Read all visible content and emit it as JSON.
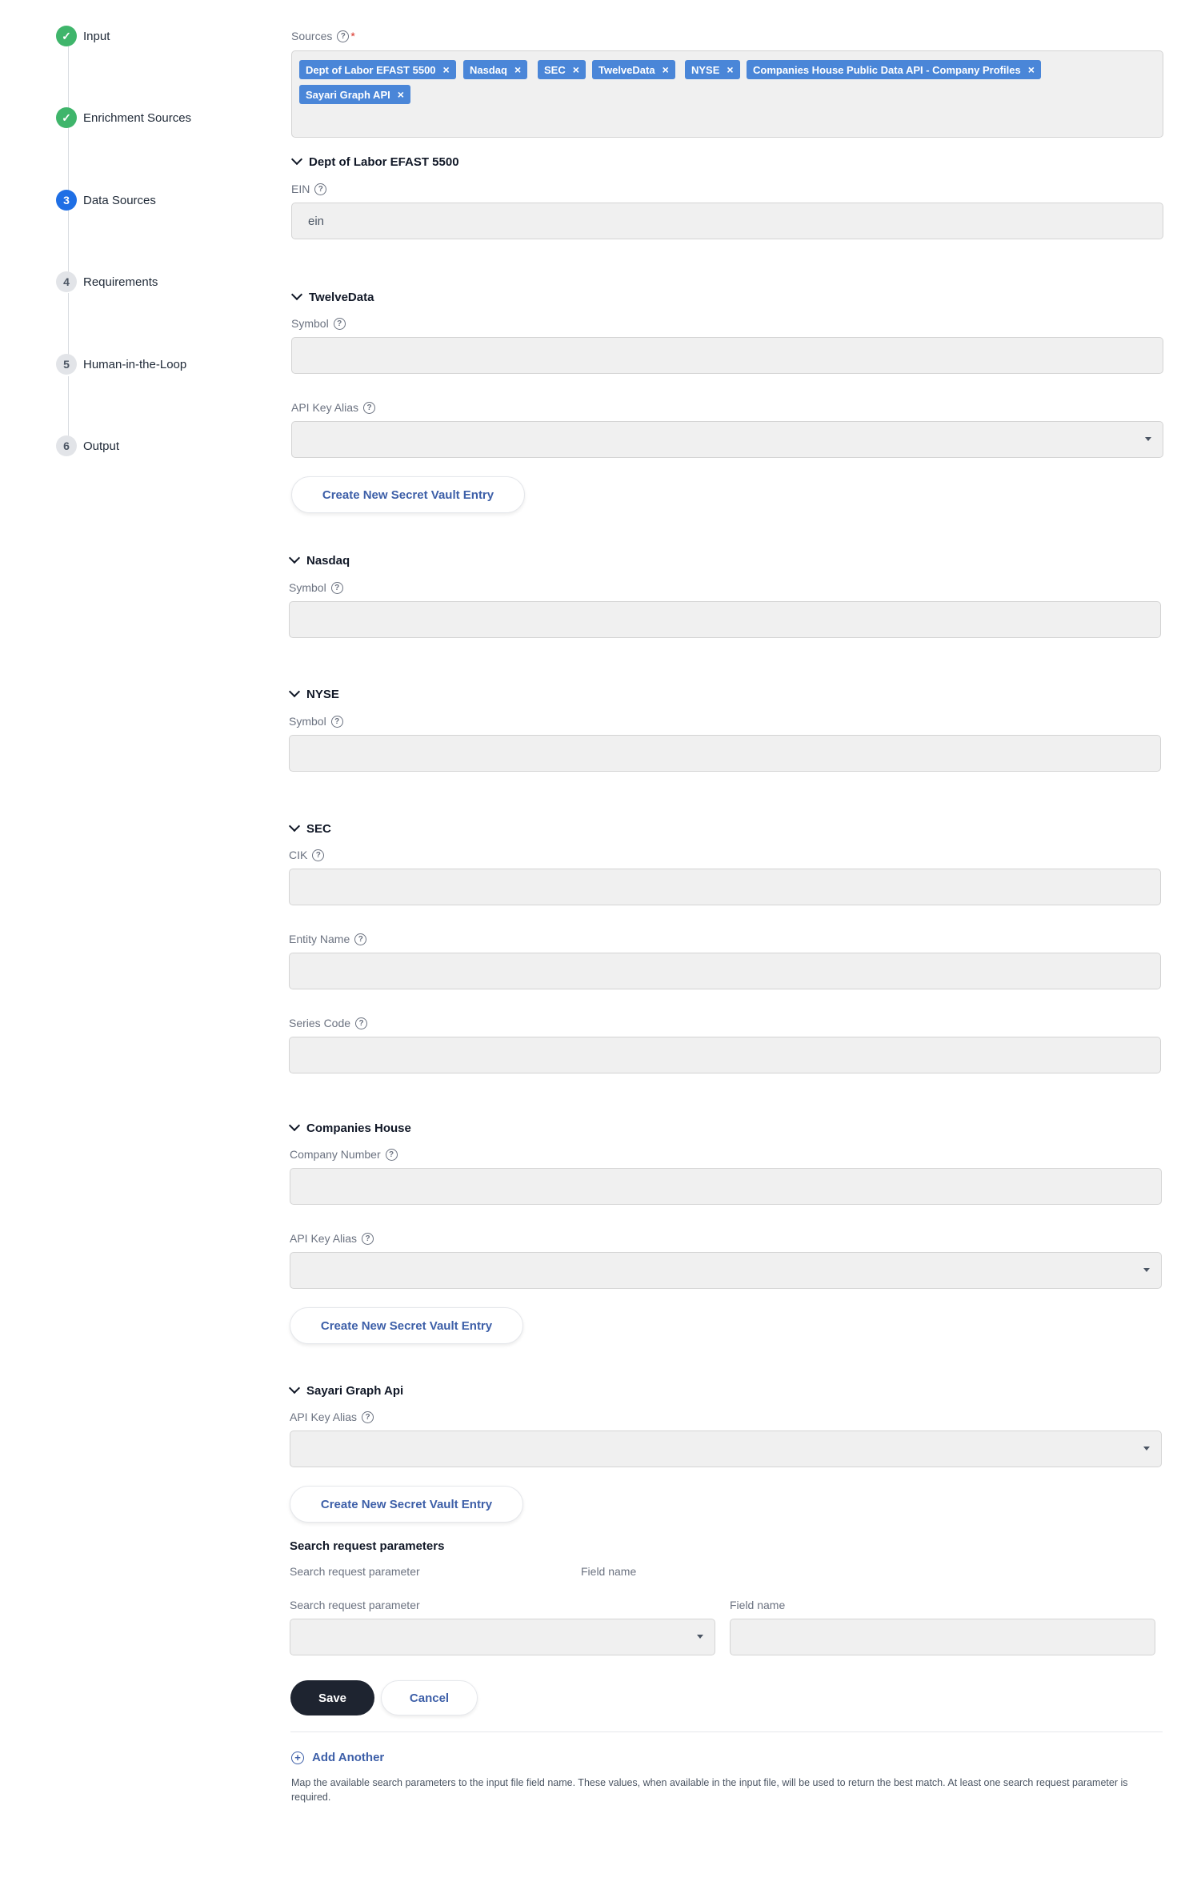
{
  "stepper": {
    "steps": [
      {
        "label": "Input",
        "state": "done",
        "num": "✓"
      },
      {
        "label": "Enrichment Sources",
        "state": "done",
        "num": "✓"
      },
      {
        "label": "Data Sources",
        "state": "active",
        "num": "3"
      },
      {
        "label": "Requirements",
        "state": "todo",
        "num": "4"
      },
      {
        "label": "Human-in-the-Loop",
        "state": "todo",
        "num": "5"
      },
      {
        "label": "Output",
        "state": "todo",
        "num": "6"
      }
    ]
  },
  "sources": {
    "label": "Sources",
    "chips": [
      "Dept of Labor EFAST 5500",
      "Nasdaq",
      "SEC",
      "TwelveData",
      "NYSE",
      "Companies House Public Data API - Company Profiles",
      "Sayari Graph API"
    ]
  },
  "dept_labor": {
    "title": "Dept of Labor EFAST 5500",
    "ein_label": "EIN",
    "ein_value": "ein"
  },
  "twelvedata": {
    "title": "TwelveData",
    "symbol_label": "Symbol",
    "api_key_label": "API Key Alias",
    "vault_button": "Create New Secret Vault Entry"
  },
  "nasdaq": {
    "title": "Nasdaq",
    "symbol_label": "Symbol"
  },
  "nyse": {
    "title": "NYSE",
    "symbol_label": "Symbol"
  },
  "sec": {
    "title": "SEC",
    "cik_label": "CIK",
    "entity_label": "Entity Name",
    "series_label": "Series Code"
  },
  "companies_house": {
    "title": "Companies House",
    "company_number_label": "Company Number",
    "api_key_label": "API Key Alias",
    "vault_button": "Create New Secret Vault Entry"
  },
  "sayari": {
    "title": "Sayari Graph Api",
    "api_key_label": "API Key Alias",
    "vault_button": "Create New Secret Vault Entry"
  },
  "search_params": {
    "title": "Search request parameters",
    "col_param": "Search request parameter",
    "col_field": "Field name",
    "param_label": "Search request parameter",
    "field_label": "Field name",
    "save": "Save",
    "cancel": "Cancel",
    "add_another": "Add Another",
    "help": "Map the available search parameters to the input file field name. These values, when available in the input file, will be used to return the best match. At least one search request parameter is required."
  }
}
